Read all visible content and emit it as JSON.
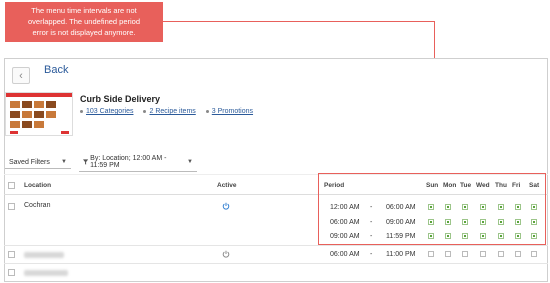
{
  "callout": {
    "line1": "The menu time intervals are not",
    "line2": "overlapped. The undefined period",
    "line3": "error is not displayed anymore."
  },
  "header": {
    "back_label": "Back"
  },
  "menu": {
    "title": "Curb Side Delivery",
    "links": [
      "103 Categories",
      "2 Recipe items",
      "3 Promotions"
    ]
  },
  "filters": {
    "saved_label": "Saved Filters",
    "by_label": "By: Location; 12:00 AM - 11:59 PM"
  },
  "table": {
    "headers": {
      "location": "Location",
      "active": "Active",
      "period": "Period",
      "days": [
        "Sun",
        "Mon",
        "Tue",
        "Wed",
        "Thu",
        "Fri",
        "Sat"
      ]
    },
    "rows": [
      {
        "location": "Cochran",
        "periods": [
          {
            "start": "12:00 AM",
            "sep": "-",
            "end": "06:00 AM"
          },
          {
            "start": "06:00 AM",
            "sep": "-",
            "end": "09:00 AM"
          },
          {
            "start": "09:00 AM",
            "sep": "-",
            "end": "11:59 PM"
          }
        ]
      },
      {
        "location": "",
        "periods": [
          {
            "start": "06:00 AM",
            "sep": "-",
            "end": "11:00 PM"
          }
        ]
      }
    ]
  },
  "colors": {
    "accent": "#e8605b",
    "link": "#2b5a9a",
    "active_icon": "#2b7bd0",
    "check_green": "#5aa43a"
  },
  "icons": {
    "back": "chevron-left-icon",
    "power": "power-icon",
    "filter": "funnel-icon"
  }
}
